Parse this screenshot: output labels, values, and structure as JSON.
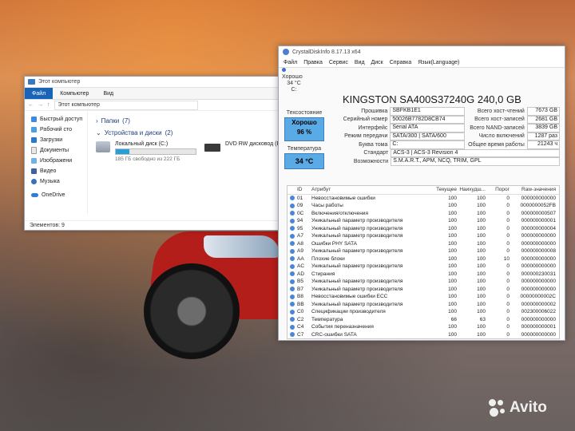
{
  "explorer": {
    "title": "Этот компьютер",
    "ribbon_tabs": [
      "Файл",
      "Компьютер",
      "Вид"
    ],
    "address": "Этот компьютер",
    "sidebar": [
      {
        "label": "Быстрый доступ",
        "icon": "star-icon"
      },
      {
        "label": "Рабочий сто",
        "icon": "desktop-icon"
      },
      {
        "label": "Загрузки",
        "icon": "download-icon"
      },
      {
        "label": "Документы",
        "icon": "document-icon"
      },
      {
        "label": "Изображени",
        "icon": "image-icon"
      },
      {
        "label": "Видео",
        "icon": "video-icon"
      },
      {
        "label": "Музыка",
        "icon": "music-icon"
      },
      {
        "label": "OneDrive",
        "icon": "cloud-icon"
      }
    ],
    "group_folders": {
      "label": "Папки",
      "count": "(7)"
    },
    "group_devices": {
      "label": "Устройства и диски",
      "count": "(2)"
    },
    "drive_c": {
      "name": "Локальный диск (C:)",
      "free": "185 ГБ свободно из 222 ГБ",
      "used_fraction": 0.17
    },
    "drive_dvd": {
      "name": "DVD RW дисковод (E"
    },
    "status": "Элементов: 9"
  },
  "cdi": {
    "title": "CrystalDiskInfo 8.17.13 x64",
    "menu": [
      "Файл",
      "Правка",
      "Сервис",
      "Вид",
      "Диск",
      "Справка",
      "Язык(Language)"
    ],
    "mini_status": {
      "health": "Хорошо",
      "temp": "34 °C",
      "drive": "C:"
    },
    "drive_title": "KINGSTON SA400S37240G 240,0 GB",
    "health_label": "Техсостояние",
    "health_value": "Хорошо",
    "health_percent": "96 %",
    "temp_label": "Температура",
    "temp_value": "34 °C",
    "info": [
      {
        "label": "Прошивка",
        "value": "SBFKB1E1",
        "rlabel": "Всего хост-чтений",
        "rvalue": "7673 GB"
      },
      {
        "label": "Серийный номер",
        "value": "50026B7782D8CB74",
        "rlabel": "Всего хост-записей",
        "rvalue": "2681 GB"
      },
      {
        "label": "Интерфейс",
        "value": "Serial ATA",
        "rlabel": "Всего NAND-записей",
        "rvalue": "3839 GB"
      },
      {
        "label": "Режим передачи",
        "value": "SATA/300 | SATA/600",
        "rlabel": "Число включений",
        "rvalue": "1287 раз"
      },
      {
        "label": "Буква тома",
        "value": "C:",
        "rlabel": "Общее время работы",
        "rvalue": "21243 ч"
      }
    ],
    "standard": {
      "label": "Стандарт",
      "value": "ACS-3 | ACS-3 Revision 4"
    },
    "features": {
      "label": "Возможности",
      "value": "S.M.A.R.T., APM, NCQ, TRIM, GPL"
    },
    "smart_header": {
      "id": "ID",
      "attr": "Атрибут",
      "cur": "Текущее",
      "worst": "Наихудш...",
      "thr": "Порог",
      "raw": "Raw-значения"
    },
    "smart_rows": [
      {
        "id": "01",
        "attr": "Невосстановимые ошибки",
        "cur": "100",
        "worst": "100",
        "thr": "0",
        "raw": "000000000000"
      },
      {
        "id": "09",
        "attr": "Часы работы",
        "cur": "100",
        "worst": "100",
        "thr": "0",
        "raw": "0000000052FB"
      },
      {
        "id": "0C",
        "attr": "Включения/отключения",
        "cur": "100",
        "worst": "100",
        "thr": "0",
        "raw": "000000000507"
      },
      {
        "id": "94",
        "attr": "Уникальный параметр производителя",
        "cur": "100",
        "worst": "100",
        "thr": "0",
        "raw": "000000000001"
      },
      {
        "id": "95",
        "attr": "Уникальный параметр производителя",
        "cur": "100",
        "worst": "100",
        "thr": "0",
        "raw": "000000000004"
      },
      {
        "id": "A7",
        "attr": "Уникальный параметр производителя",
        "cur": "100",
        "worst": "100",
        "thr": "0",
        "raw": "000000000000"
      },
      {
        "id": "A8",
        "attr": "Ошибки PHY SATA",
        "cur": "100",
        "worst": "100",
        "thr": "0",
        "raw": "000000000000"
      },
      {
        "id": "A9",
        "attr": "Уникальный параметр производителя",
        "cur": "100",
        "worst": "100",
        "thr": "0",
        "raw": "000000000008"
      },
      {
        "id": "AA",
        "attr": "Плохие блоки",
        "cur": "100",
        "worst": "100",
        "thr": "10",
        "raw": "000000000000"
      },
      {
        "id": "AC",
        "attr": "Уникальный параметр производителя",
        "cur": "100",
        "worst": "100",
        "thr": "0",
        "raw": "000000000000"
      },
      {
        "id": "AD",
        "attr": "Стирания",
        "cur": "100",
        "worst": "100",
        "thr": "0",
        "raw": "000000230031"
      },
      {
        "id": "B5",
        "attr": "Уникальный параметр производителя",
        "cur": "100",
        "worst": "100",
        "thr": "0",
        "raw": "000000000000"
      },
      {
        "id": "B7",
        "attr": "Уникальный параметр производителя",
        "cur": "100",
        "worst": "100",
        "thr": "0",
        "raw": "000000000000"
      },
      {
        "id": "B8",
        "attr": "Невосстановимые ошибки ECC",
        "cur": "100",
        "worst": "100",
        "thr": "0",
        "raw": "00000000002C"
      },
      {
        "id": "BB",
        "attr": "Уникальный параметр производителя",
        "cur": "100",
        "worst": "100",
        "thr": "0",
        "raw": "000000000002"
      },
      {
        "id": "C0",
        "attr": "Спецификации производителя",
        "cur": "100",
        "worst": "100",
        "thr": "0",
        "raw": "002300006022"
      },
      {
        "id": "C2",
        "attr": "Температура",
        "cur": "66",
        "worst": "63",
        "thr": "0",
        "raw": "000000000000"
      },
      {
        "id": "C4",
        "attr": "События переназначения",
        "cur": "100",
        "worst": "100",
        "thr": "0",
        "raw": "000000000001"
      },
      {
        "id": "C7",
        "attr": "CRC-ошибки SATA",
        "cur": "100",
        "worst": "100",
        "thr": "0",
        "raw": "000000000000"
      }
    ]
  },
  "watermark": {
    "text": "Avito"
  }
}
